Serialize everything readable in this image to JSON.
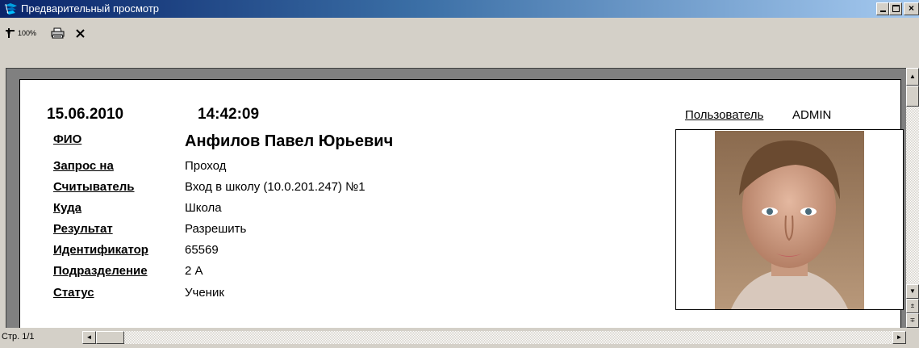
{
  "window": {
    "title": "Предварительный просмотр",
    "controls": {
      "minimize": "_",
      "maximize": "□",
      "close": "×"
    }
  },
  "toolbar": {
    "zoom_label": "100%",
    "zoom_icon": "zoom-pin-icon",
    "print_icon": "printer-icon",
    "close_icon": "close-icon"
  },
  "report": {
    "date": "15.06.2010",
    "time": "14:42:09",
    "user_label": "Пользователь",
    "user_value": "ADMIN",
    "fio_label": "ФИО",
    "fio_value": "Анфилов Павел Юрьевич",
    "fields": [
      {
        "label": "Запрос на",
        "value": "Проход"
      },
      {
        "label": "Считыватель",
        "value": "Вход в школу (10.0.201.247) №1"
      },
      {
        "label": "Куда",
        "value": "Школа"
      },
      {
        "label": "Результат",
        "value": "Разрешить"
      },
      {
        "label": "Идентификатор",
        "value": "65569"
      },
      {
        "label": "Подразделение",
        "value": "2 А"
      },
      {
        "label": "Статус",
        "value": "Ученик"
      }
    ]
  },
  "statusbar": {
    "page": "Стр. 1/1"
  },
  "colors": {
    "title_start": "#0a246a",
    "title_end": "#a6caf0",
    "chrome": "#d4d0c8",
    "workspace": "#808080"
  }
}
